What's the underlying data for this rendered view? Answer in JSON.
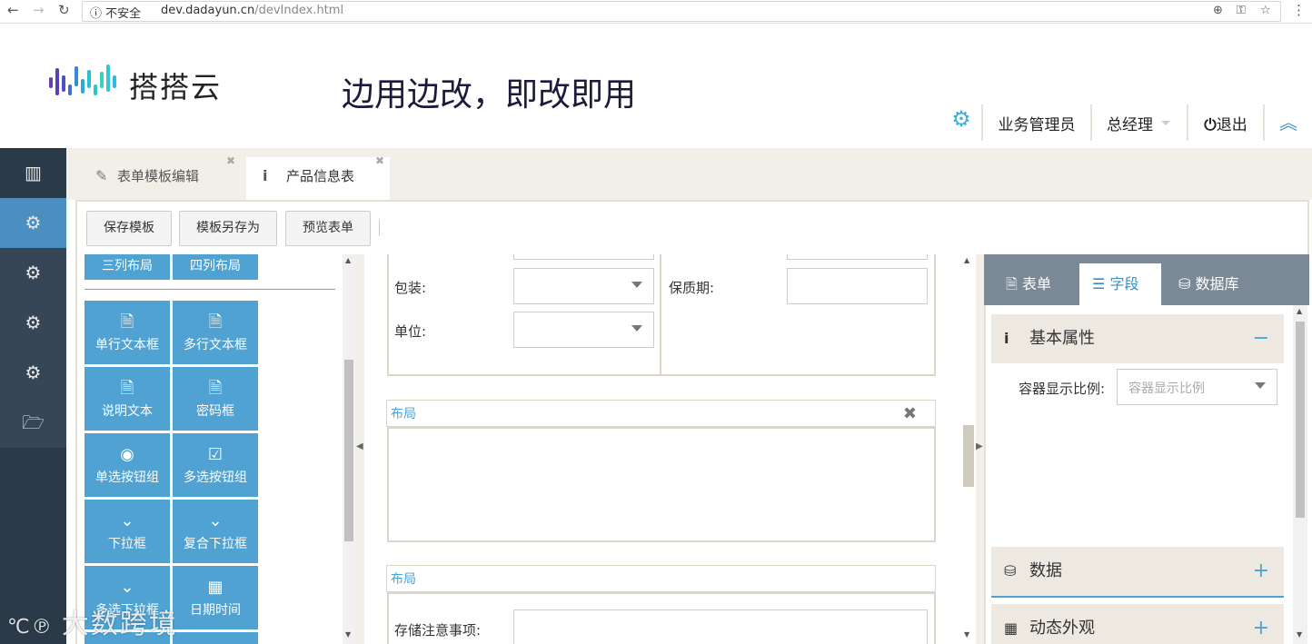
{
  "browser": {
    "security": "不安全",
    "host": "dev.dadayun.cn",
    "path": "/devIndex.html"
  },
  "header": {
    "brand": "搭搭云",
    "slogan": "边用边改，即改即用",
    "role": "业务管理员",
    "user": "总经理",
    "logout": "退出"
  },
  "sidebar": {
    "items": [
      "modules-icon",
      "gear-icon",
      "gear-icon",
      "gear-icon",
      "gear-icon",
      "folder-icon"
    ]
  },
  "tabs": [
    {
      "label": "表单模板编辑",
      "active": false
    },
    {
      "label": "产品信息表",
      "active": true
    }
  ],
  "toolbar": {
    "save": "保存模板",
    "save_as": "模板另存为",
    "preview": "预览表单"
  },
  "palette": {
    "layouts": [
      "三列布局",
      "四列布局"
    ],
    "components": [
      {
        "label": "单行文本框",
        "icon": "document-icon"
      },
      {
        "label": "多行文本框",
        "icon": "document-icon"
      },
      {
        "label": "说明文本",
        "icon": "document-icon"
      },
      {
        "label": "密码框",
        "icon": "document-icon"
      },
      {
        "label": "单选按钮组",
        "icon": "radio-icon"
      },
      {
        "label": "多选按钮组",
        "icon": "checkbox-icon"
      },
      {
        "label": "下拉框",
        "icon": "chevron-down-icon"
      },
      {
        "label": "复合下拉框",
        "icon": "chevron-down-icon"
      },
      {
        "label": "多选下拉框",
        "icon": "chevron-down-icon"
      },
      {
        "label": "日期时间",
        "icon": "calendar-icon"
      }
    ]
  },
  "canvas": {
    "fields": {
      "packaging": "包装:",
      "unit": "单位:",
      "shelf_life": "保质期:",
      "storage_notes": "存储注意事项:"
    },
    "layout_label": "布局",
    "layout_label2": "布局"
  },
  "properties": {
    "tabs": [
      "表单",
      "字段",
      "数据库"
    ],
    "active_tab": "字段",
    "sections": {
      "basic": "基本属性",
      "data": "数据",
      "dynamic": "动态外观"
    },
    "ratio_label": "容器显示比例:",
    "ratio_placeholder": "容器显示比例"
  },
  "watermark": "大数跨境",
  "colors": {
    "sidebar": "#2a3a48",
    "component": "#4fa2d2",
    "accent": "#3a8fc9"
  }
}
